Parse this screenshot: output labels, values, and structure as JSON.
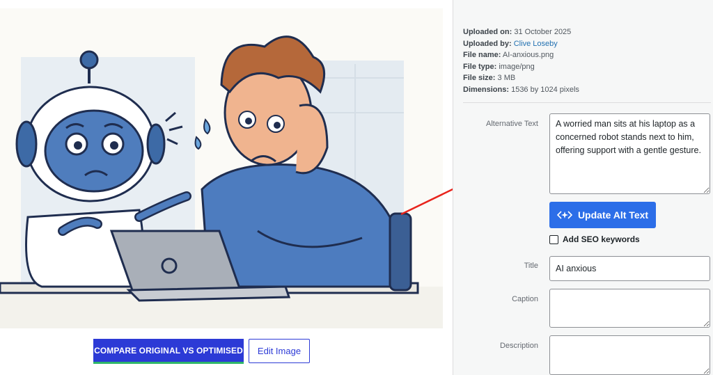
{
  "preview": {
    "image_alt": "A worried man sits at his laptop as a concerned robot stands next to him, offering support with a gentle gesture."
  },
  "actions": {
    "compare_label": "COMPARE ORIGINAL VS OPTIMISED",
    "edit_label": "Edit Image"
  },
  "details": {
    "uploaded_on_label": "Uploaded on:",
    "uploaded_on": "31 October 2025",
    "uploaded_by_label": "Uploaded by:",
    "uploaded_by": "Clive Loseby",
    "file_name_label": "File name:",
    "file_name": "AI-anxious.png",
    "file_type_label": "File type:",
    "file_type": "image/png",
    "file_size_label": "File size:",
    "file_size": "3 MB",
    "dimensions_label": "Dimensions:",
    "dimensions": "1536 by 1024 pixels"
  },
  "fields": {
    "alt_label": "Alternative Text",
    "alt_value": "A worried man sits at his laptop as a concerned robot stands next to him, offering support with a gentle gesture.",
    "update_button": "Update Alt Text",
    "seo_label": "Add SEO keywords",
    "title_label": "Title",
    "title_value": "AI anxious",
    "caption_label": "Caption",
    "caption_value": "",
    "description_label": "Description",
    "description_value": ""
  },
  "colors": {
    "primary": "#2c3ad6",
    "update": "#2c6ee8",
    "arrow": "#e8241c",
    "link": "#2271b1"
  }
}
